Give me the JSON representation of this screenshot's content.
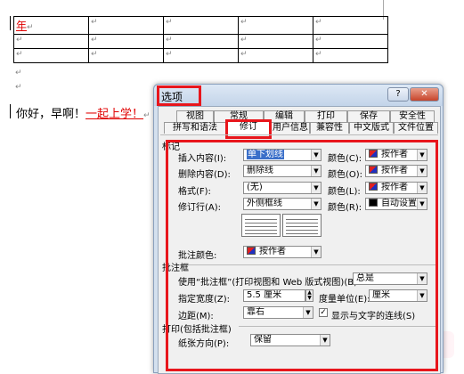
{
  "document": {
    "table_first_cell": "年",
    "para_mark": "↵",
    "line_text_plain": "你好，早啊！",
    "line_text_inserted": "一起上学！",
    "table_rows": 3,
    "table_cols": 6
  },
  "dialog": {
    "title": "选项",
    "help_label": "?",
    "close_label": "✕",
    "tabs_row1": [
      "视图",
      "常规",
      "编辑",
      "打印",
      "保存",
      "安全性"
    ],
    "tabs_row2": [
      "拼写和语法",
      "修订",
      "用户信息",
      "兼容性",
      "中文版式",
      "文件位置"
    ],
    "active_tab": "修订",
    "section_markup": "标记",
    "insert_label": "插入内容(I):",
    "insert_value": "单下划线",
    "delete_label": "删除内容(D):",
    "delete_value": "删除线",
    "format_label": "格式(F):",
    "format_value": "(无)",
    "revline_label": "修订行(A):",
    "revline_value": "外侧框线",
    "color_label1": "颜色(C):",
    "color_label2": "颜色(O):",
    "color_label3": "颜色(L):",
    "color_label4": "颜色(R):",
    "color_value_byauthor": "按作者",
    "color_value_auto": "自动设置",
    "comment_color_label": "批注颜色:",
    "comment_color_value": "按作者",
    "section_balloons": "批注框",
    "use_balloons_label": "使用“批注框”(打印视图和 Web 版式视图)(B):",
    "use_balloons_value": "总是",
    "width_label": "指定宽度(Z):",
    "width_value": "5.5 厘米",
    "unit_label": "度量单位(E):",
    "unit_value": "厘米",
    "margin_label": "边距(M):",
    "margin_value": "靠右",
    "show_lines_label": "显示与文字的连线(S)",
    "show_lines_checked": true,
    "section_print": "打印(包括批注框)",
    "paper_label": "纸张方向(P):",
    "paper_value": "保留",
    "accent_red": "#e8161c"
  }
}
